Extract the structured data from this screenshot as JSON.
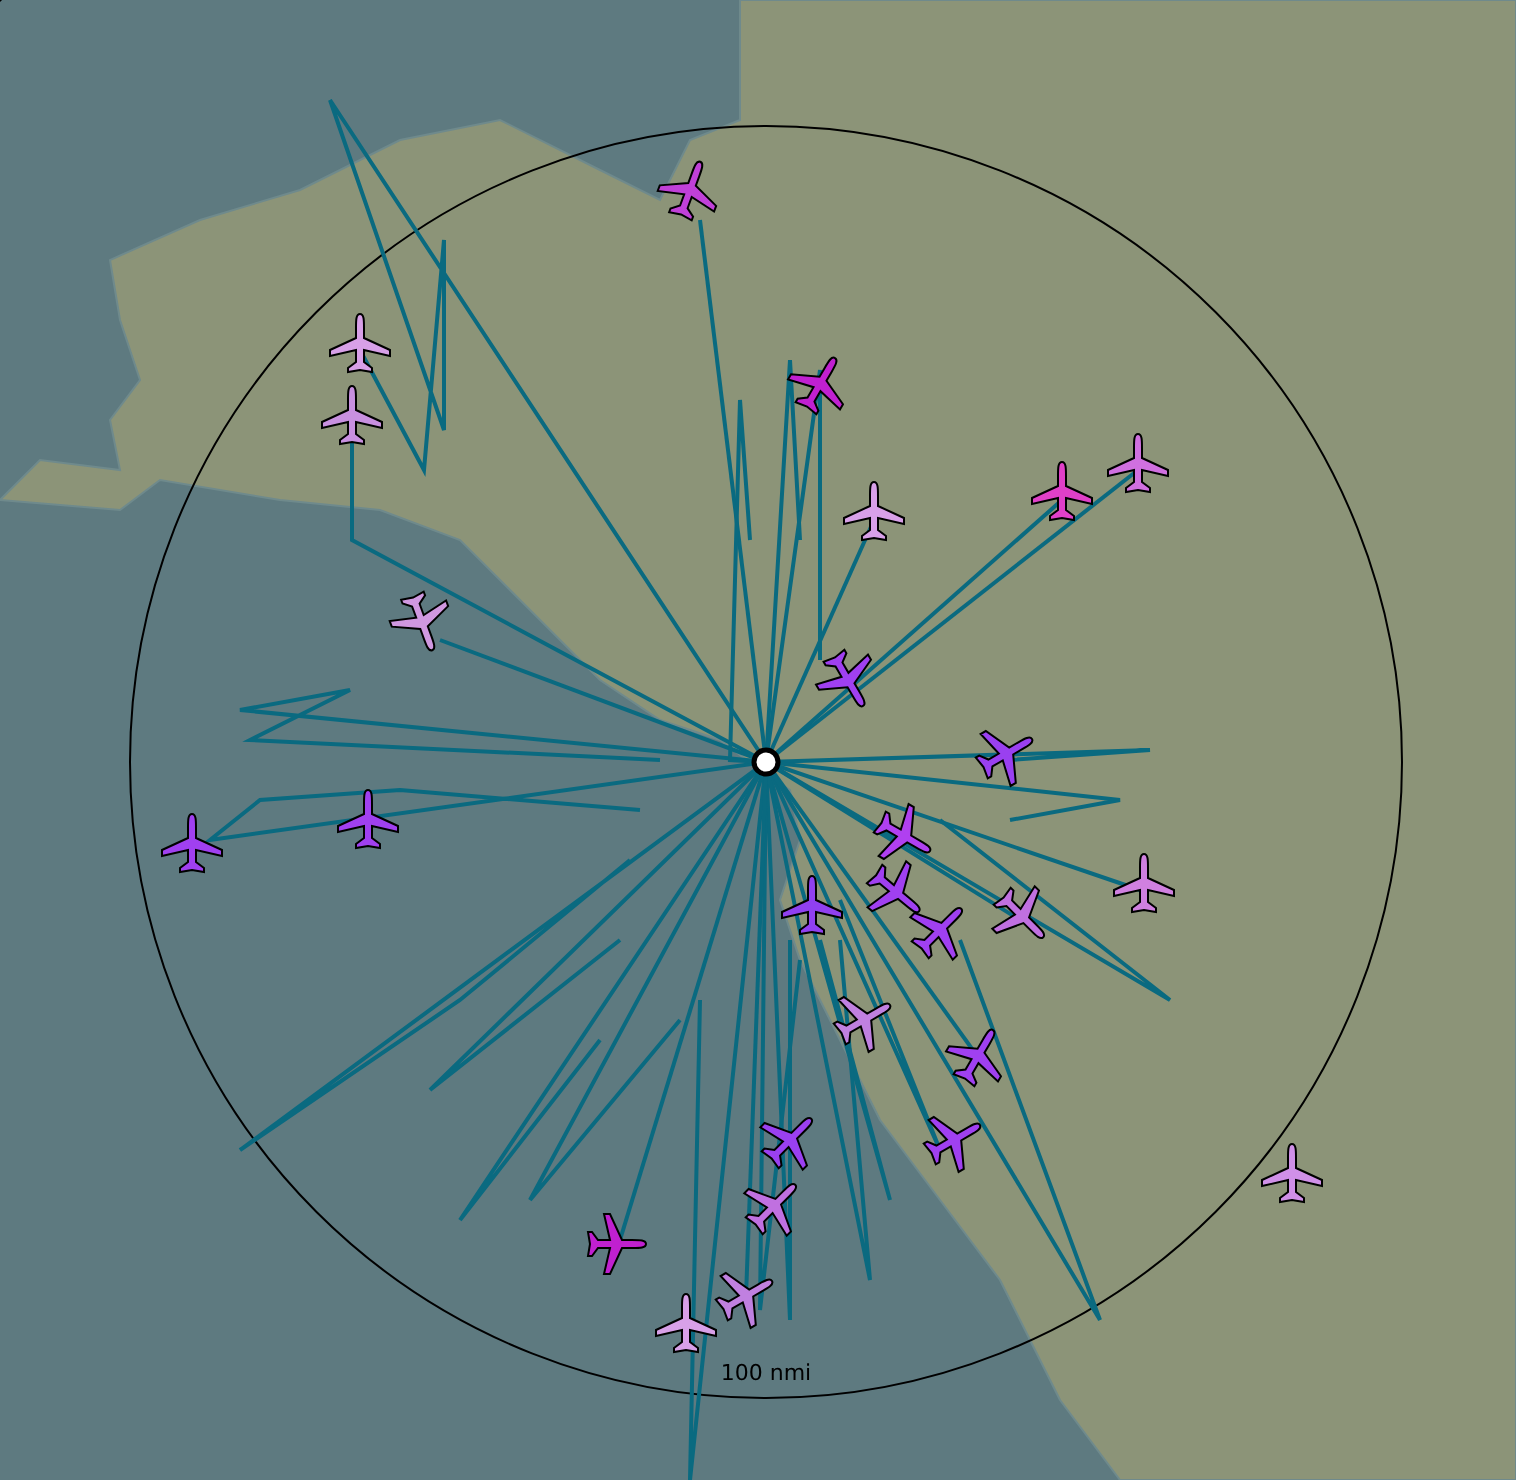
{
  "map": {
    "range_label": "100 nmi",
    "aircraft": [
      {
        "color": "#c040d8"
      },
      {
        "color": "#d8a0e8"
      },
      {
        "color": "#c890e0"
      },
      {
        "color": "#c020d0"
      },
      {
        "color": "#d8a0e8"
      },
      {
        "color": "#e040c8"
      },
      {
        "color": "#d070e0"
      },
      {
        "color": "#d098e0"
      },
      {
        "color": "#a040f0"
      },
      {
        "color": "#9a40f0"
      },
      {
        "color": "#a040f0"
      },
      {
        "color": "#a040f0"
      },
      {
        "color": "#b040f0"
      },
      {
        "color": "#a040f0"
      },
      {
        "color": "#9040f0"
      },
      {
        "color": "#a040f0"
      },
      {
        "color": "#c070e0"
      },
      {
        "color": "#d080e0"
      },
      {
        "color": "#c080e0"
      },
      {
        "color": "#a040f0"
      },
      {
        "color": "#9a40f0"
      },
      {
        "color": "#a040f0"
      },
      {
        "color": "#c070e0"
      },
      {
        "color": "#c020d0"
      },
      {
        "color": "#c080e0"
      },
      {
        "color": "#d8a0e8"
      },
      {
        "color": "#d090e8"
      }
    ]
  }
}
